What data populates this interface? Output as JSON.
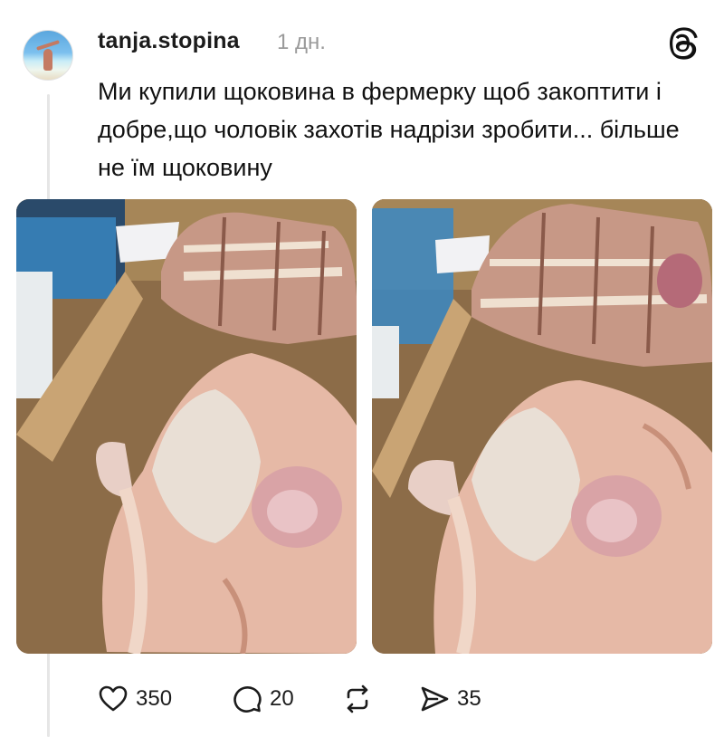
{
  "post": {
    "username": "tanja.stopina",
    "timestamp": "1 дн.",
    "text": "Ми купили щоковина в фермерку щоб закоптити і добре,що чоловік захотів надрізи зробити... більше не їм щоковину",
    "images": [
      {
        "icon": "meat-photo"
      },
      {
        "icon": "meat-photo"
      }
    ]
  },
  "actions": {
    "likes": "350",
    "replies": "20",
    "shares": "35"
  },
  "icons": {
    "logo": "threads-logo-icon",
    "like": "heart-icon",
    "reply": "comment-bubble-icon",
    "repost": "repost-icon",
    "share": "send-icon"
  }
}
